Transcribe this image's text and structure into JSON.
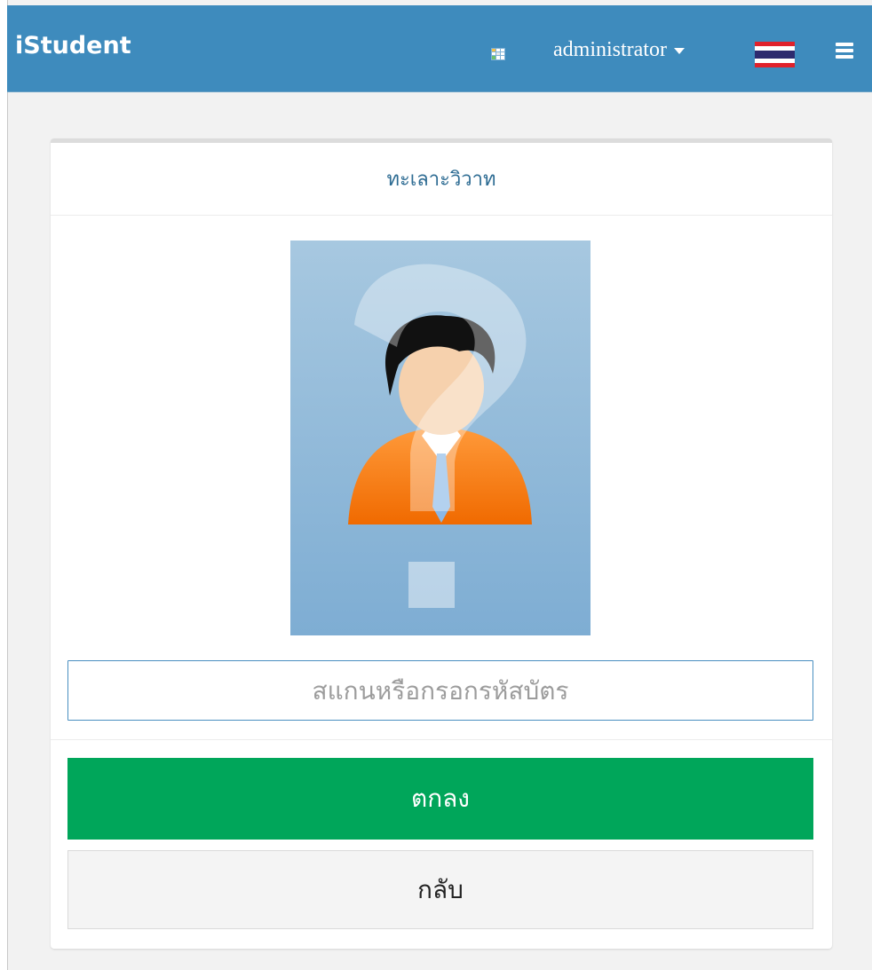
{
  "navbar": {
    "brand": "iStudent",
    "apps_icon": "apps-grid-icon",
    "user_label": "administrator",
    "flag_icon": "thai-flag-icon",
    "menu_icon": "hamburger-menu-icon",
    "background_color": "#3e8bbd"
  },
  "card": {
    "header_title": "ทะเลาะวิวาท",
    "photo_icon": "unknown-person-placeholder",
    "input": {
      "placeholder": "สแกนหรือกรอกรหัสบัตร",
      "value": ""
    },
    "ok_button_label": "ตกลง",
    "back_button_label": "กลับ"
  },
  "colors": {
    "accent": "#3e8bbd",
    "ok_button": "#00a65a",
    "header_text": "#2e6c93"
  }
}
